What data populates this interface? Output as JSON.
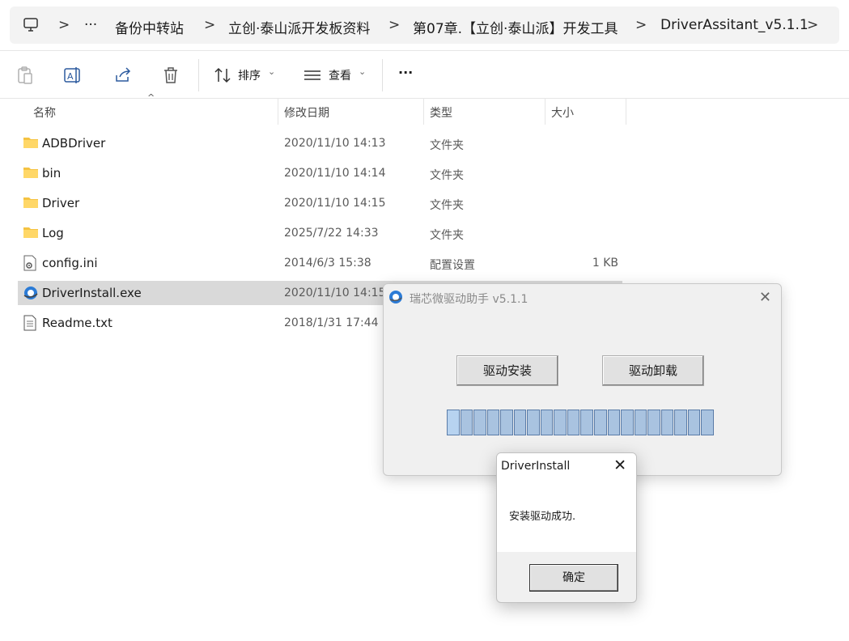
{
  "breadcrumb": {
    "items": [
      "备份中转站",
      "立创·泰山派开发板资料",
      "第07章.【立创·泰山派】开发工具",
      "DriverAssitant_v5.1.1"
    ],
    "more": "···",
    "separator": ">"
  },
  "toolbar": {
    "sort_label": "排序",
    "view_label": "查看",
    "more_label": "···"
  },
  "columns": {
    "name": "名称",
    "date": "修改日期",
    "type": "类型",
    "size": "大小"
  },
  "files": [
    {
      "name": "ADBDriver",
      "date": "2020/11/10 14:13",
      "type": "文件夹",
      "size": "",
      "icon": "folder-icon"
    },
    {
      "name": "bin",
      "date": "2020/11/10 14:14",
      "type": "文件夹",
      "size": "",
      "icon": "folder-icon"
    },
    {
      "name": "Driver",
      "date": "2020/11/10 14:15",
      "type": "文件夹",
      "size": "",
      "icon": "folder-icon"
    },
    {
      "name": "Log",
      "date": "2025/7/22 14:33",
      "type": "文件夹",
      "size": "",
      "icon": "folder-icon"
    },
    {
      "name": "config.ini",
      "date": "2014/6/3 15:38",
      "type": "配置设置",
      "size": "1 KB",
      "icon": "settings-file-icon"
    },
    {
      "name": "DriverInstall.exe",
      "date": "2020/11/10 14:15",
      "type": "",
      "size": "",
      "icon": "exe-icon",
      "selected": true
    },
    {
      "name": "Readme.txt",
      "date": "2018/1/31 17:44",
      "type": "",
      "size": "",
      "icon": "text-file-icon"
    }
  ],
  "driver_window": {
    "title": "瑞芯微驱动助手 v5.1.1",
    "install_button": "驱动安装",
    "uninstall_button": "驱动卸载",
    "progress_segments": 20
  },
  "message_box": {
    "title": "DriverInstall",
    "message": "安装驱动成功.",
    "ok_button": "确定"
  },
  "colors": {
    "accent_folder": "#f5c342",
    "selected_row": "#d9d9d9",
    "progress": "#a9c3e0"
  }
}
